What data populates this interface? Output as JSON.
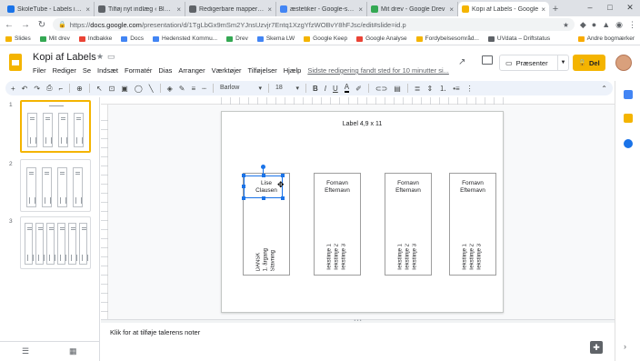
{
  "browser": {
    "tabs": [
      {
        "title": "SkoleTube - Labels inclu",
        "color": "#1a73e8",
        "active": false
      },
      {
        "title": "Tilføj nyt indlæg ‹ Blogg",
        "color": "#5f6368",
        "active": false
      },
      {
        "title": "Redigerbare mappery ge",
        "color": "#5f6368",
        "active": false
      },
      {
        "title": "æstetiker - Google-søgni",
        "color": "#4285f4",
        "active": false
      },
      {
        "title": "Mit drev - Google Drev",
        "color": "#34a853",
        "active": false
      },
      {
        "title": "Kopi af Labels - Google",
        "color": "#f4b400",
        "active": true
      }
    ],
    "new_tab": "+",
    "url_secure": "https://",
    "url_host": "docs.google.com",
    "url_path": "/presentation/d/1TgLbGx9mSm2YJnsUzvjr7Entq1XzgYfzWOBvY8hFJsc/edit#slide=id.p",
    "bookmarks": [
      {
        "label": "Slides",
        "color": "#f4b400"
      },
      {
        "label": "Mit drev",
        "color": "#34a853"
      },
      {
        "label": "Indbakke",
        "color": "#ea4335"
      },
      {
        "label": "Docs",
        "color": "#4285f4"
      },
      {
        "label": "Hedensted Kommu...",
        "color": "#4285f4"
      },
      {
        "label": "Drev",
        "color": "#34a853"
      },
      {
        "label": "Skema LW",
        "color": "#4285f4"
      },
      {
        "label": "Google Keep",
        "color": "#f4b400"
      },
      {
        "label": "Google Analyse",
        "color": "#ea4335"
      },
      {
        "label": "Fordybelsesområd...",
        "color": "#f4b400"
      },
      {
        "label": "UVdata – Driftstatus",
        "color": "#5f6368"
      }
    ],
    "other_bookmarks": "Andre bogmærker"
  },
  "doc": {
    "title": "Kopi af Labels",
    "menu": [
      "Filer",
      "Rediger",
      "Se",
      "Indsæt",
      "Formatér",
      "Dias",
      "Arranger",
      "Værktøjer",
      "Tilføjelser",
      "Hjælp"
    ],
    "last_edit": "Sidste redigering fandt sted for 10 minutter si...",
    "present_label": "Præsenter",
    "share_label": "Del"
  },
  "toolbar": {
    "font": "Barlow",
    "size": "18",
    "bold": "B",
    "italic": "I",
    "underline": "U",
    "color": "A"
  },
  "slides": [
    {
      "number": "1",
      "active": true
    },
    {
      "number": "2",
      "active": false
    },
    {
      "number": "3",
      "active": false
    }
  ],
  "slide": {
    "title": "Label 4,9 x 11",
    "labels": [
      {
        "name_lines": [
          "Lise",
          "Clausen"
        ],
        "text_lines": [
          "DANSK",
          "1. årgang",
          "Stavning"
        ]
      },
      {
        "name_lines": [
          "Fornavn",
          "Efternavn"
        ],
        "text_lines": [
          "Tekstlinje 1",
          "Tekstlinje 2",
          "Tekstlinje 3"
        ]
      },
      {
        "name_lines": [
          "Fornavn",
          "Efternavn"
        ],
        "text_lines": [
          "Tekstlinje 1",
          "Tekstlinje 2",
          "Tekstlinje 3"
        ]
      },
      {
        "name_lines": [
          "Fornavn",
          "Efternavn"
        ],
        "text_lines": [
          "Tekstlinje 1",
          "Tekstlinje 2",
          "Tekstlinje 3"
        ]
      }
    ]
  },
  "notes": {
    "placeholder": "Klik for at tilføje talerens noter"
  },
  "icons": {
    "star": "★",
    "plus": "+",
    "back": "←",
    "forward": "→",
    "reload": "↻"
  }
}
